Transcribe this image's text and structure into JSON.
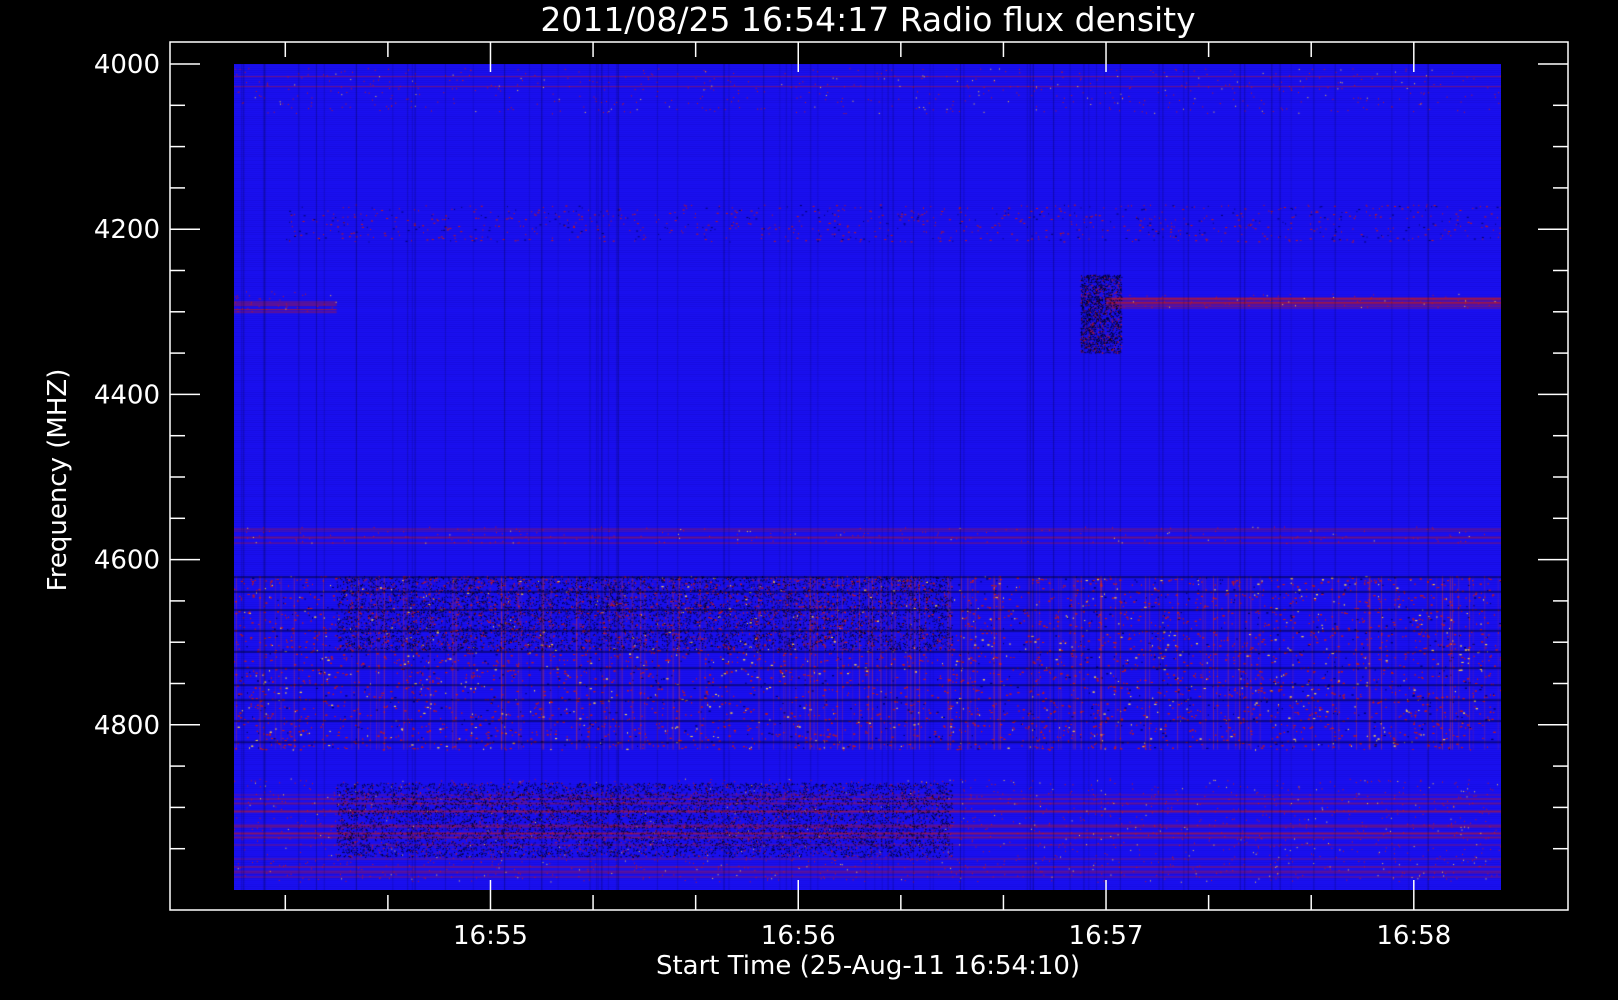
{
  "chart_data": {
    "type": "heatmap",
    "title": "2011/08/25 16:54:17 Radio flux density",
    "xlabel": "Start Time (25-Aug-11 16:54:10)",
    "ylabel": "Frequency (MHZ)",
    "x_range": [
      "16:54:10",
      "16:58:17"
    ],
    "y_range": [
      4000,
      5000
    ],
    "y_ticks": [
      "4000",
      "4200",
      "4400",
      "4600",
      "4800"
    ],
    "x_ticks": [
      "16:55",
      "16:56",
      "16:57",
      "16:58"
    ],
    "grid": false,
    "colors": {
      "background": "#000000",
      "field": "#1a10f2",
      "dark": "#00006a",
      "red": "#c81818",
      "yellow": "#ffd040",
      "axis": "#ffffff"
    },
    "bands": [
      {
        "y0": 4005,
        "y1": 4060,
        "start": "16:54:10",
        "end": "16:58:17",
        "style": "red-lines",
        "intensity": 0.5
      },
      {
        "y0": 4170,
        "y1": 4215,
        "start": "16:54:20",
        "end": "16:58:17",
        "style": "red-speckle",
        "intensity": 0.35
      },
      {
        "y0": 4275,
        "y1": 4300,
        "start": "16:54:10",
        "end": "16:54:30",
        "style": "red-lines",
        "intensity": 0.9
      },
      {
        "y0": 4278,
        "y1": 4295,
        "start": "16:57:00",
        "end": "16:58:17",
        "style": "red-lines",
        "intensity": 0.8
      },
      {
        "y0": 4255,
        "y1": 4350,
        "start": "16:56:55",
        "end": "16:57:03",
        "style": "dark-burst",
        "intensity": 0.9
      },
      {
        "y0": 4560,
        "y1": 4580,
        "start": "16:54:10",
        "end": "16:58:17",
        "style": "red-lines",
        "intensity": 0.5
      },
      {
        "y0": 4620,
        "y1": 4830,
        "start": "16:54:10",
        "end": "16:58:17",
        "style": "red-yellow-speckle",
        "intensity": 0.8
      },
      {
        "y0": 4620,
        "y1": 4710,
        "start": "16:54:30",
        "end": "16:56:30",
        "style": "dark-speckle",
        "intensity": 0.7
      },
      {
        "y0": 4865,
        "y1": 4990,
        "start": "16:54:10",
        "end": "16:58:17",
        "style": "red-lines",
        "intensity": 0.7
      },
      {
        "y0": 4870,
        "y1": 4960,
        "start": "16:54:30",
        "end": "16:56:30",
        "style": "dark-speckle",
        "intensity": 0.8
      }
    ]
  }
}
